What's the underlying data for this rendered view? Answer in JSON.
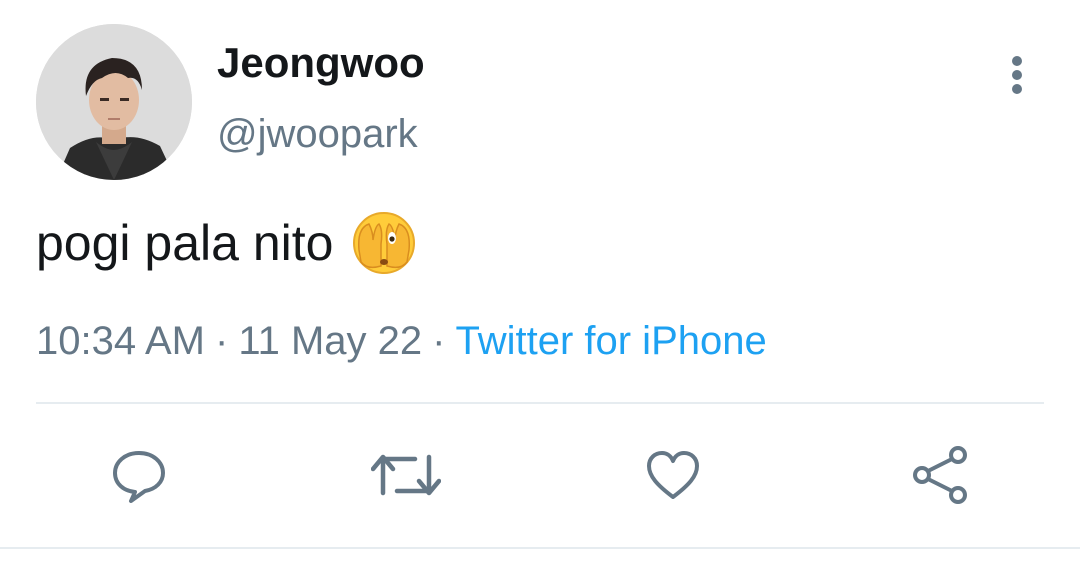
{
  "user": {
    "display_name": "Jeongwoo",
    "handle": "@jwoopark",
    "avatar": "profile-photo"
  },
  "tweet": {
    "text": "pogi pala nito",
    "emoji": "face-with-peeking-eye",
    "time": "10:34 AM",
    "separator": "·",
    "date": "11 May 22",
    "source": "Twitter for iPhone"
  },
  "actions": {
    "reply_icon": "speech-bubble-icon",
    "retweet_icon": "retweet-icon",
    "like_icon": "heart-icon",
    "share_icon": "share-icon",
    "more_icon": "vertical-dots-icon"
  },
  "colors": {
    "text": "#14171a",
    "secondary": "#657786",
    "link": "#1da1f2",
    "divider": "#e6ecf0"
  }
}
